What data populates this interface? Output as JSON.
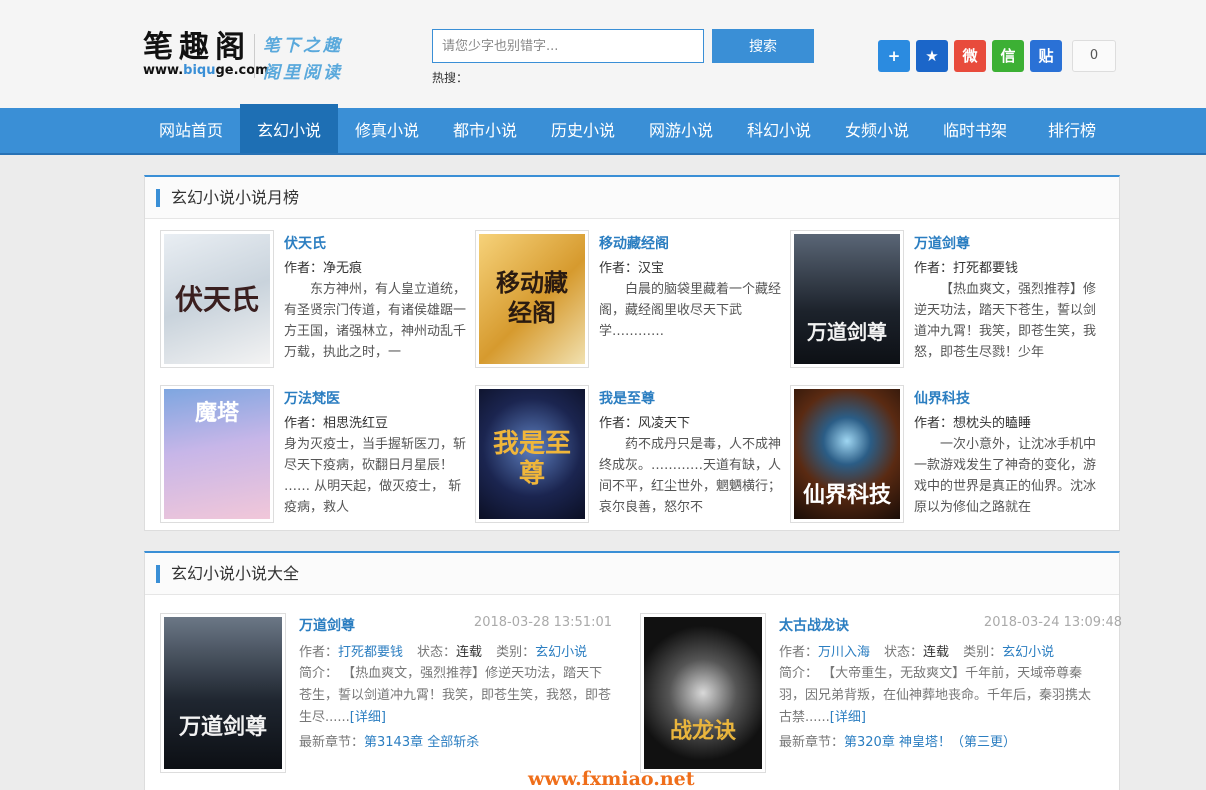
{
  "header": {
    "logo_name": "笔趣阁",
    "logo_domain_pre": "www.",
    "logo_domain_hl": "biqu",
    "logo_domain_post": "ge.com",
    "slogan_line1": "笔下之趣",
    "slogan_line2": "阁里阅读",
    "search_placeholder": "请您少字也别错字...",
    "search_button": "搜索",
    "hot_label": "热搜：",
    "share_count": "0",
    "share_icons": [
      {
        "name": "plus-icon",
        "glyph": "+",
        "color": "#2b8be0"
      },
      {
        "name": "star-icon",
        "glyph": "★",
        "color": "#1b66c9"
      },
      {
        "name": "weibo-icon",
        "glyph": "微",
        "color": "#e84b3c"
      },
      {
        "name": "wechat-icon",
        "glyph": "信",
        "color": "#3cb034"
      },
      {
        "name": "tieba-icon",
        "glyph": "贴",
        "color": "#2a71d6"
      }
    ]
  },
  "nav": {
    "items": [
      "网站首页",
      "玄幻小说",
      "修真小说",
      "都市小说",
      "历史小说",
      "网游小说",
      "科幻小说",
      "女频小说",
      "临时书架",
      "排行榜"
    ],
    "active_index": 1
  },
  "monthly": {
    "title": "玄幻小说小说月榜",
    "author_label": "作者：",
    "books": [
      {
        "title": "伏天氏",
        "author": "净无痕",
        "desc": "东方神州，有人皇立道统，有圣贤宗门传道，有诸侯雄踞一方王国，诸强林立，神州动乱千万载，执此之时，一",
        "cover_text": "伏天氏"
      },
      {
        "title": "移动藏经阁",
        "author": "汉宝",
        "desc": "白晨的脑袋里藏着一个藏经阁，藏经阁里收尽天下武学…………",
        "cover_text": "移动藏经阁"
      },
      {
        "title": "万道剑尊",
        "author": "打死都要钱",
        "desc": "【热血爽文，强烈推荐】修逆天功法，踏天下苍生，誓以剑道冲九霄！我笑，即苍生笑，我怒，即苍生尽戮！少年",
        "cover_text": "万道剑尊"
      },
      {
        "title": "万法梵医",
        "author": "相思洗红豆",
        "desc": "身为灭疫士，当手握斩医刀，斩尽天下疫病，砍翻日月星辰！    ……    从明天起，做灭疫士，    斩疫病，救人",
        "cover_text": "魔塔"
      },
      {
        "title": "我是至尊",
        "author": "风凌天下",
        "desc": "药不成丹只是毒，人不成神终成灰。…………天道有缺，人间不平，红尘世外，魍魉横行；哀尔良善，怒尔不",
        "cover_text": "我是至尊"
      },
      {
        "title": "仙界科技",
        "author": "想枕头的瞌睡",
        "desc": "一次小意外，让沈冰手机中一款游戏发生了神奇的变化，游戏中的世界是真正的仙界。沈冰原以为修仙之路就在",
        "cover_text": "仙界科技"
      }
    ]
  },
  "all": {
    "title": "玄幻小说小说大全",
    "author_label": "作者：",
    "status_label": "状态：",
    "category_label": "类别：",
    "intro_label": "简介：",
    "more_label": "[详细]",
    "latest_label": "最新章节：",
    "books": [
      {
        "title": "万道剑尊",
        "time": "2018-03-28 13:51:01",
        "author": "打死都要钱",
        "status": "连载",
        "category": "玄幻小说",
        "desc": "   【热血爽文，强烈推荐】修逆天功法，踏天下苍生，誓以剑道冲九霄！我笑，即苍生笑，我怒，即苍生尽......",
        "latest": "第3143章 全部斩杀",
        "cover_text": "万道剑尊"
      },
      {
        "title": "太古战龙诀",
        "time": "2018-03-24 13:09:48",
        "author": "万川入海",
        "status": "连载",
        "category": "玄幻小说",
        "desc": "   【大帝重生，无敌爽文】千年前，天域帝尊秦羽，因兄弟背叛，在仙神葬地丧命。千年后，秦羽携太古禁......",
        "latest": "第320章 神皇塔！（第三更）",
        "cover_text": "战龙诀"
      }
    ]
  },
  "watermark": "www.fxmiao.net"
}
